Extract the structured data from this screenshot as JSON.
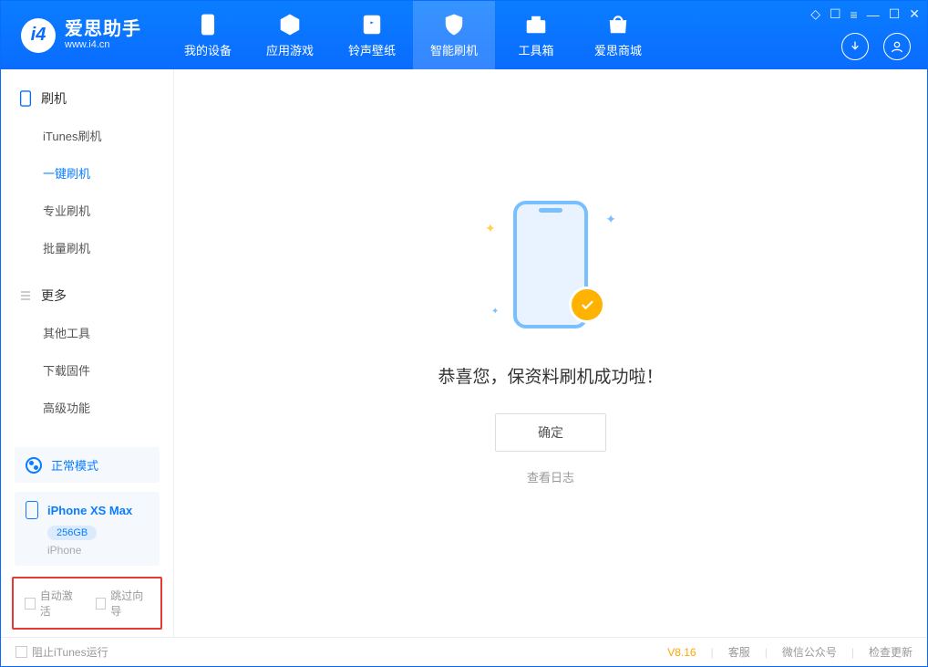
{
  "header": {
    "app_title": "爱思助手",
    "app_sub": "www.i4.cn",
    "tabs": [
      {
        "label": "我的设备"
      },
      {
        "label": "应用游戏"
      },
      {
        "label": "铃声壁纸"
      },
      {
        "label": "智能刷机"
      },
      {
        "label": "工具箱"
      },
      {
        "label": "爱思商城"
      }
    ]
  },
  "sidebar": {
    "group1_title": "刷机",
    "group1": [
      {
        "label": "iTunes刷机"
      },
      {
        "label": "一键刷机"
      },
      {
        "label": "专业刷机"
      },
      {
        "label": "批量刷机"
      }
    ],
    "group2_title": "更多",
    "group2": [
      {
        "label": "其他工具"
      },
      {
        "label": "下载固件"
      },
      {
        "label": "高级功能"
      }
    ],
    "mode_label": "正常模式",
    "device_name": "iPhone XS Max",
    "device_storage": "256GB",
    "device_type": "iPhone",
    "cb_auto_activate": "自动激活",
    "cb_skip_guide": "跳过向导"
  },
  "main": {
    "success_text": "恭喜您，保资料刷机成功啦！",
    "ok_button": "确定",
    "view_log": "查看日志"
  },
  "footer": {
    "block_itunes": "阻止iTunes运行",
    "version": "V8.16",
    "links": [
      {
        "label": "客服"
      },
      {
        "label": "微信公众号"
      },
      {
        "label": "检查更新"
      }
    ]
  }
}
